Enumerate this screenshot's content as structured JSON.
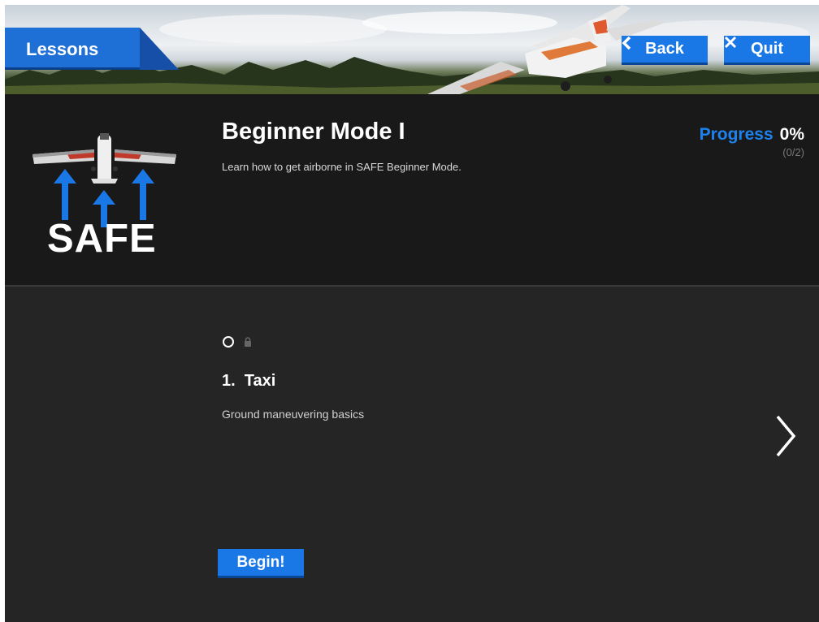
{
  "nav": {
    "lessons_tab": "Lessons",
    "back_label": "Back",
    "quit_label": "Quit"
  },
  "course": {
    "logo_text": "SAFE",
    "title": "Beginner Mode I",
    "description": "Learn how to get airborne in SAFE Beginner Mode.",
    "progress_label": "Progress",
    "progress_value": "0%",
    "progress_count": "(0/2)"
  },
  "lesson": {
    "status_icons": [
      "circle-icon",
      "lock-icon"
    ],
    "title": "1.  Taxi",
    "description": "Ground maneuvering basics",
    "begin_label": "Begin!"
  },
  "colors": {
    "accent": "#1a78e6",
    "progress_text": "#1e82ee",
    "header_bg": "#191919",
    "body_bg": "#252525"
  }
}
